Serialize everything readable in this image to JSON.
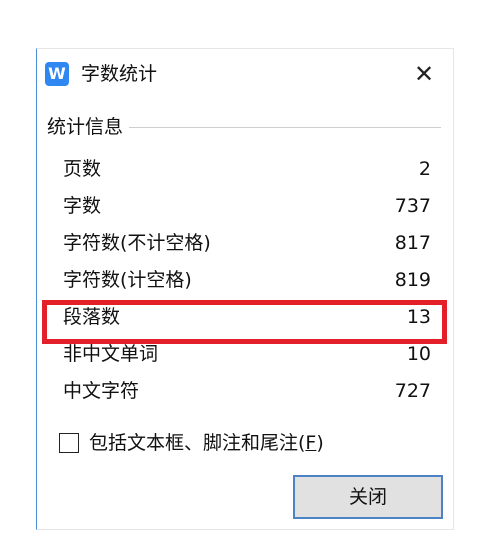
{
  "dialog": {
    "app_icon_text": "W",
    "title": "字数统计",
    "close_glyph": "✕"
  },
  "group": {
    "title": "统计信息"
  },
  "stats": [
    {
      "label": "页数",
      "value": "2"
    },
    {
      "label": "字数",
      "value": "737"
    },
    {
      "label": "字符数(不计空格)",
      "value": "817"
    },
    {
      "label": "字符数(计空格)",
      "value": "819"
    },
    {
      "label": "段落数",
      "value": "13"
    },
    {
      "label": "非中文单词",
      "value": "10"
    },
    {
      "label": "中文字符",
      "value": "727"
    }
  ],
  "checkbox": {
    "label_prefix": "包括文本框、脚注和尾注(",
    "accelerator": "F",
    "label_suffix": ")",
    "checked": false
  },
  "buttons": {
    "close_label": "关闭"
  },
  "colors": {
    "highlight_border": "#e3202a",
    "app_icon_bg": "#2f87f2",
    "button_border": "#4d83c6"
  }
}
